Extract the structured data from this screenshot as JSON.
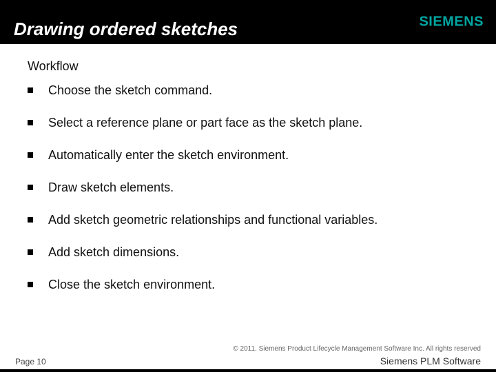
{
  "header": {
    "title": "Drawing ordered sketches",
    "brand": "SIEMENS"
  },
  "body": {
    "section_heading": "Workflow",
    "bullets": [
      "Choose the sketch command.",
      "Select a reference plane or part face as the sketch plane.",
      "Automatically enter the sketch environment.",
      "Draw sketch elements.",
      "Add sketch geometric relationships and functional variables.",
      "Add sketch dimensions.",
      "Close the sketch environment."
    ]
  },
  "footer": {
    "copyright": "© 2011. Siemens Product Lifecycle Management Software Inc. All rights reserved",
    "page": "Page 10",
    "product": "Siemens PLM Software"
  }
}
